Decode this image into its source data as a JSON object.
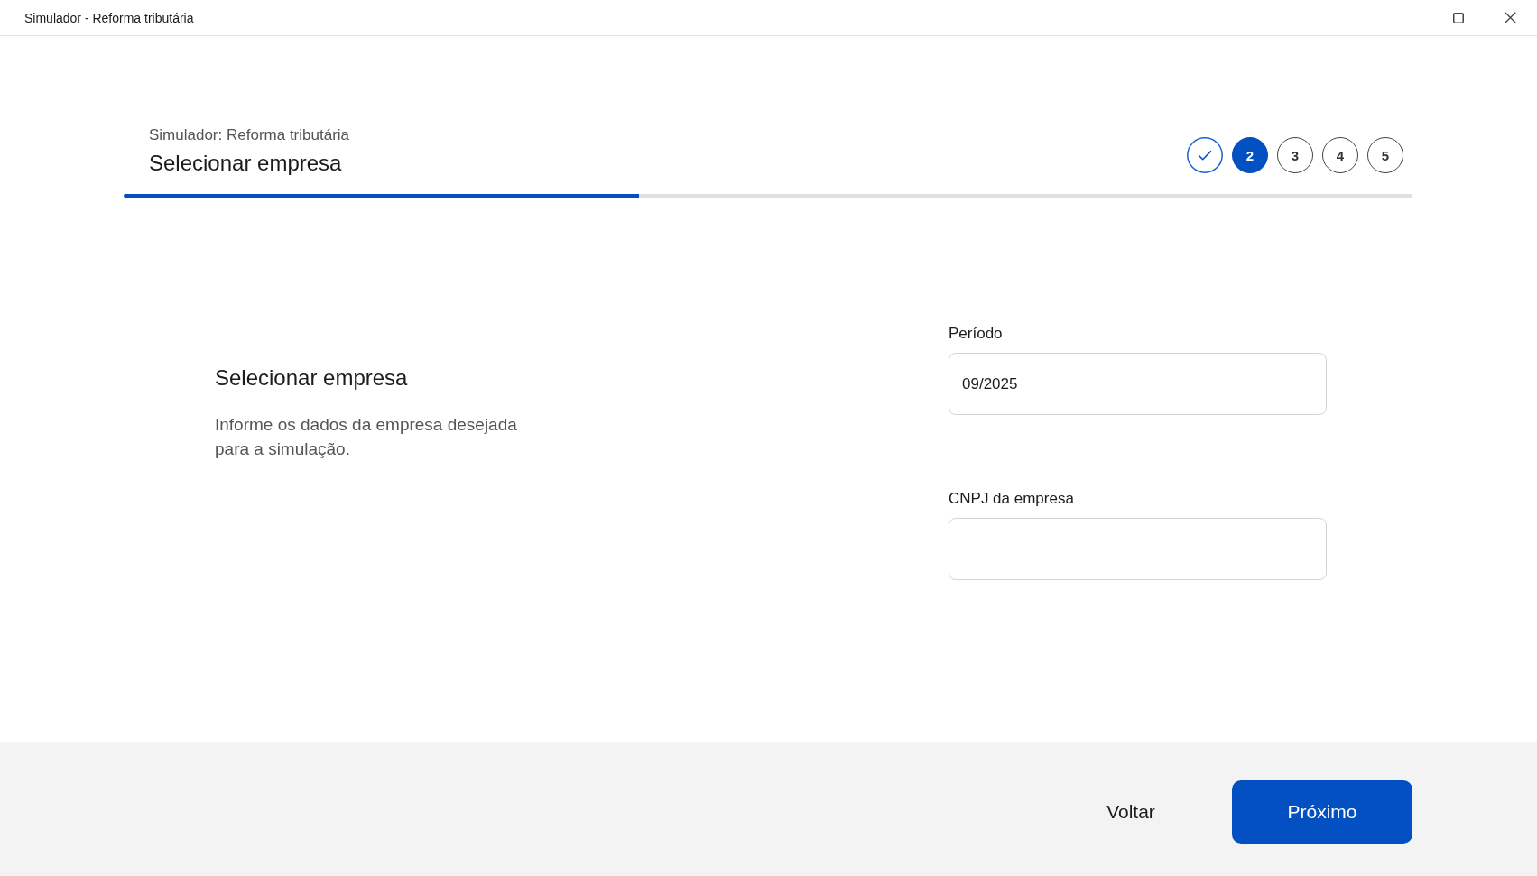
{
  "window": {
    "title": "Simulador - Reforma tributária"
  },
  "header": {
    "subtitle": "Simulador: Reforma tributária",
    "title": "Selecionar empresa",
    "steps": [
      {
        "kind": "done"
      },
      {
        "kind": "current",
        "label": "2"
      },
      {
        "kind": "upcoming",
        "label": "3"
      },
      {
        "kind": "upcoming",
        "label": "4"
      },
      {
        "kind": "upcoming",
        "label": "5"
      }
    ]
  },
  "progress": {
    "level": 0.4
  },
  "section": {
    "title": "Selecionar empresa",
    "description": "Informe os dados da empresa desejada para a simulação."
  },
  "fields": [
    {
      "label": "Período",
      "value": "09/2025"
    },
    {
      "label": "CNPJ da empresa"
    }
  ],
  "footer": {
    "buttons": [
      {
        "kind": "secondary",
        "label": "Voltar"
      },
      {
        "kind": "primary",
        "label": "Próximo"
      }
    ]
  }
}
